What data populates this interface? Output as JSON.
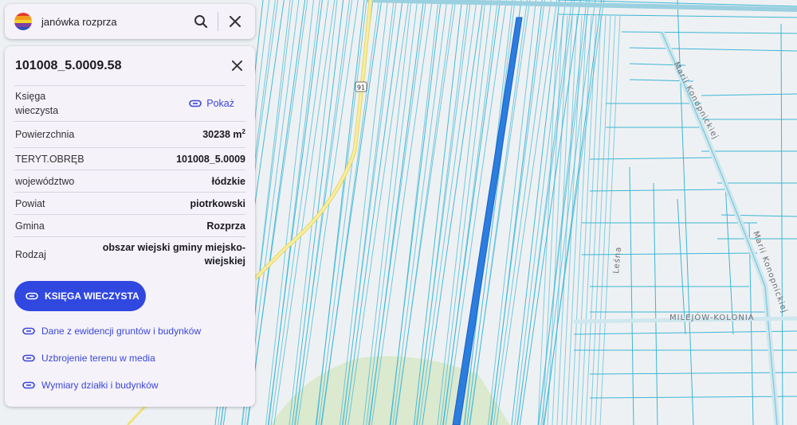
{
  "search": {
    "query": "janówka rozprza"
  },
  "logo": {
    "stripes": [
      "#e6392b",
      "#f39a1f",
      "#f4d22a",
      "#7b3fa6",
      "#2a4fb8"
    ]
  },
  "parcel": {
    "id": "101008_5.0009.58",
    "rows": [
      {
        "key": "kw",
        "label": "Księga\nwieczysta",
        "value": "Pokaż",
        "is_link": true
      },
      {
        "key": "area",
        "label": "Powierzchnia",
        "value": "30238 m",
        "sup": "2"
      },
      {
        "key": "teryt",
        "label": "TERYT.OBRĘB",
        "value": "101008_5.0009"
      },
      {
        "key": "woj",
        "label": "województwo",
        "value": "łódzkie"
      },
      {
        "key": "powiat",
        "label": "Powiat",
        "value": "piotrkowski"
      },
      {
        "key": "gmina",
        "label": "Gmina",
        "value": "Rozprza"
      },
      {
        "key": "rodzaj",
        "label": "Rodzaj",
        "value": "obszar wiejski gminy miejsko-\nwiejskiej"
      }
    ],
    "primary_button": "KSIĘGA WIECZYSTA",
    "links": [
      "Dane z ewidencji gruntów i budynków",
      "Uzbrojenie terenu w media",
      "Wymiary działki i budynków"
    ]
  },
  "map": {
    "road_number": "91",
    "labels": {
      "street_top": "Marii Konopnickiej",
      "street_right": "Marii Konopnickiej",
      "lesna": "Leśna",
      "place": "MILEJÓW-KOLONIA"
    },
    "colors": {
      "parcel_line": "#3cb6d6",
      "selected": "#2b7de0",
      "road": "#f2e27a",
      "green": "#d7e8c8",
      "background": "#eef1f3"
    }
  },
  "icons": [
    "search-icon",
    "close-icon",
    "link-icon"
  ]
}
